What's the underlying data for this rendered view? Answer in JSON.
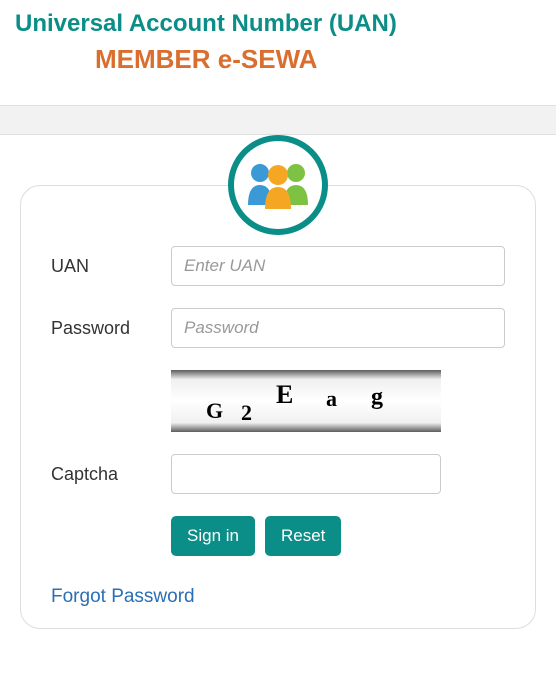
{
  "header": {
    "line1": "Universal Account Number (UAN)",
    "line2": "MEMBER e-SEWA"
  },
  "form": {
    "uan_label": "UAN",
    "uan_placeholder": "Enter UAN",
    "password_label": "Password",
    "password_placeholder": "Password",
    "captcha_label": "Captcha",
    "captcha_chars": [
      "G",
      "2",
      "E",
      "a",
      "g"
    ],
    "signin_label": "Sign in",
    "reset_label": "Reset"
  },
  "links": {
    "forgot_password": "Forgot Password"
  },
  "colors": {
    "teal": "#0a8e87",
    "orange": "#d96e2e",
    "link": "#2a6fb5"
  },
  "icons": {
    "people": "people-group-icon"
  }
}
